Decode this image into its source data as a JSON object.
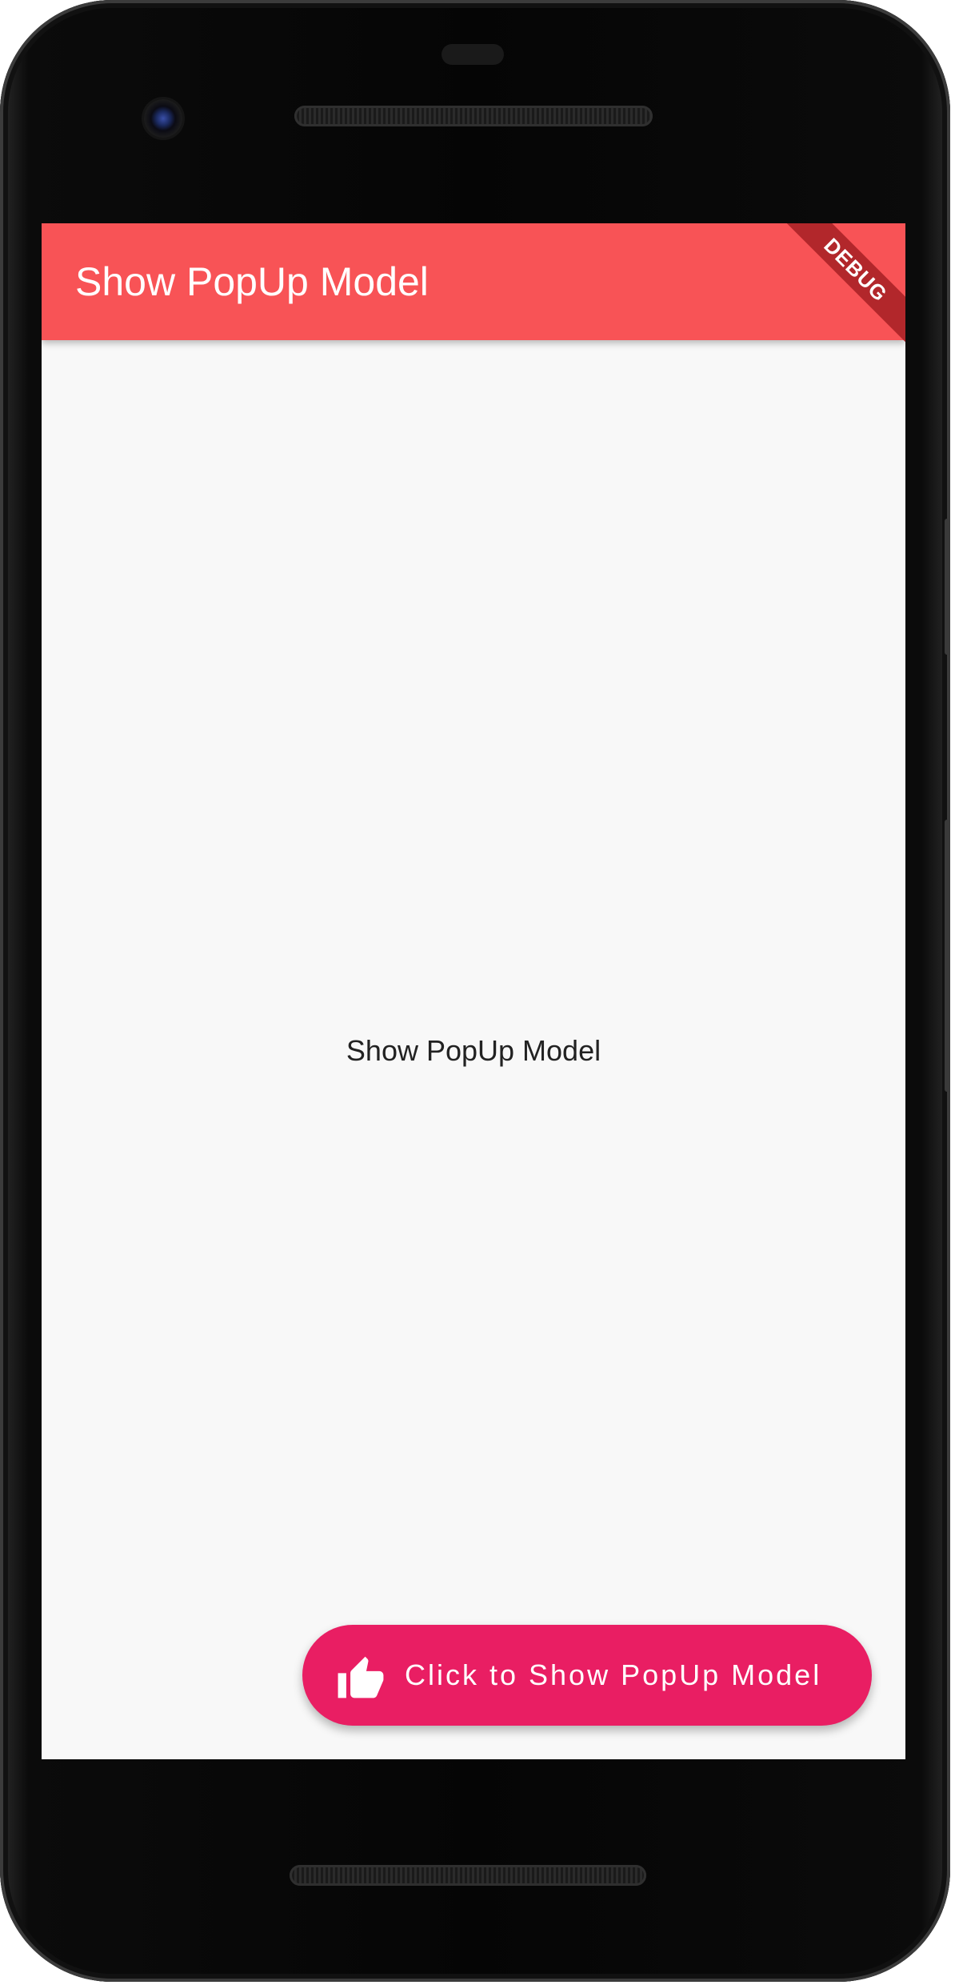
{
  "app_bar": {
    "title": "Show PopUp Model",
    "debug_banner": "DEBUG",
    "color": "#f85356"
  },
  "body": {
    "center_text": "Show PopUp Model",
    "background": "#f8f8f8"
  },
  "fab": {
    "label": "Click to Show PopUp Model",
    "icon": "thumb-up-icon",
    "color": "#e91e63"
  },
  "device": {
    "hardware": [
      "camera",
      "earpiece-speaker",
      "bottom-speaker",
      "side-buttons"
    ]
  }
}
